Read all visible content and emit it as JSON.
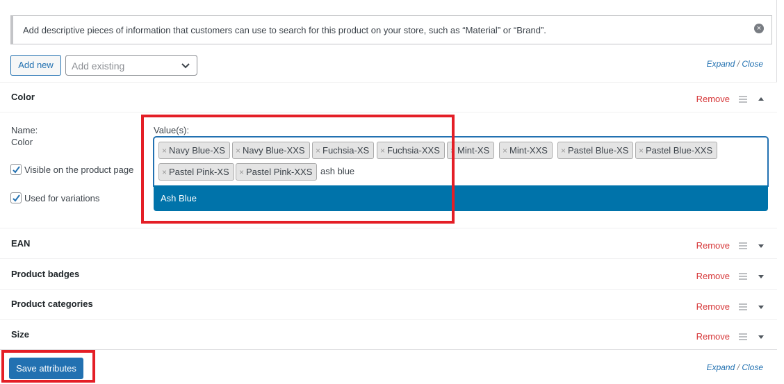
{
  "notice": {
    "text": "Add descriptive pieces of information that customers can use to search for this product on your store, such as “Material” or “Brand”.",
    "close_icon": "close-icon"
  },
  "toolbar": {
    "add_new_label": "Add new",
    "add_existing_placeholder": "Add existing"
  },
  "expand_close": {
    "expand": "Expand",
    "separator": "/",
    "close": "Close"
  },
  "remove_label": "Remove",
  "attributes": {
    "color": {
      "title": "Color",
      "name_label": "Name:",
      "name_value": "Color",
      "visible_label": "Visible on the product page",
      "visible_checked": true,
      "variations_label": "Used for variations",
      "variations_checked": true,
      "values_label": "Value(s):",
      "tags": [
        "Navy Blue-XS",
        "Navy Blue-XXS",
        "Fuchsia-XS",
        "Fuchsia-XXS",
        "Mint-XS",
        "Mint-XXS",
        "Pastel Blue-XS",
        "Pastel Blue-XXS",
        "Pastel Pink-XS",
        "Pastel Pink-XXS"
      ],
      "tag_remove_glyph": "×",
      "search_text": "ash blue",
      "suggestion": "Ash Blue"
    },
    "ean": {
      "title": "EAN"
    },
    "product_badges": {
      "title": "Product badges"
    },
    "product_categories": {
      "title": "Product categories"
    },
    "size": {
      "title": "Size"
    }
  },
  "footer": {
    "save_label": "Save attributes"
  },
  "colors": {
    "accent": "#2271b1",
    "highlight": "#0073aa",
    "remove": "#d63638",
    "annotation": "#e41e26"
  }
}
